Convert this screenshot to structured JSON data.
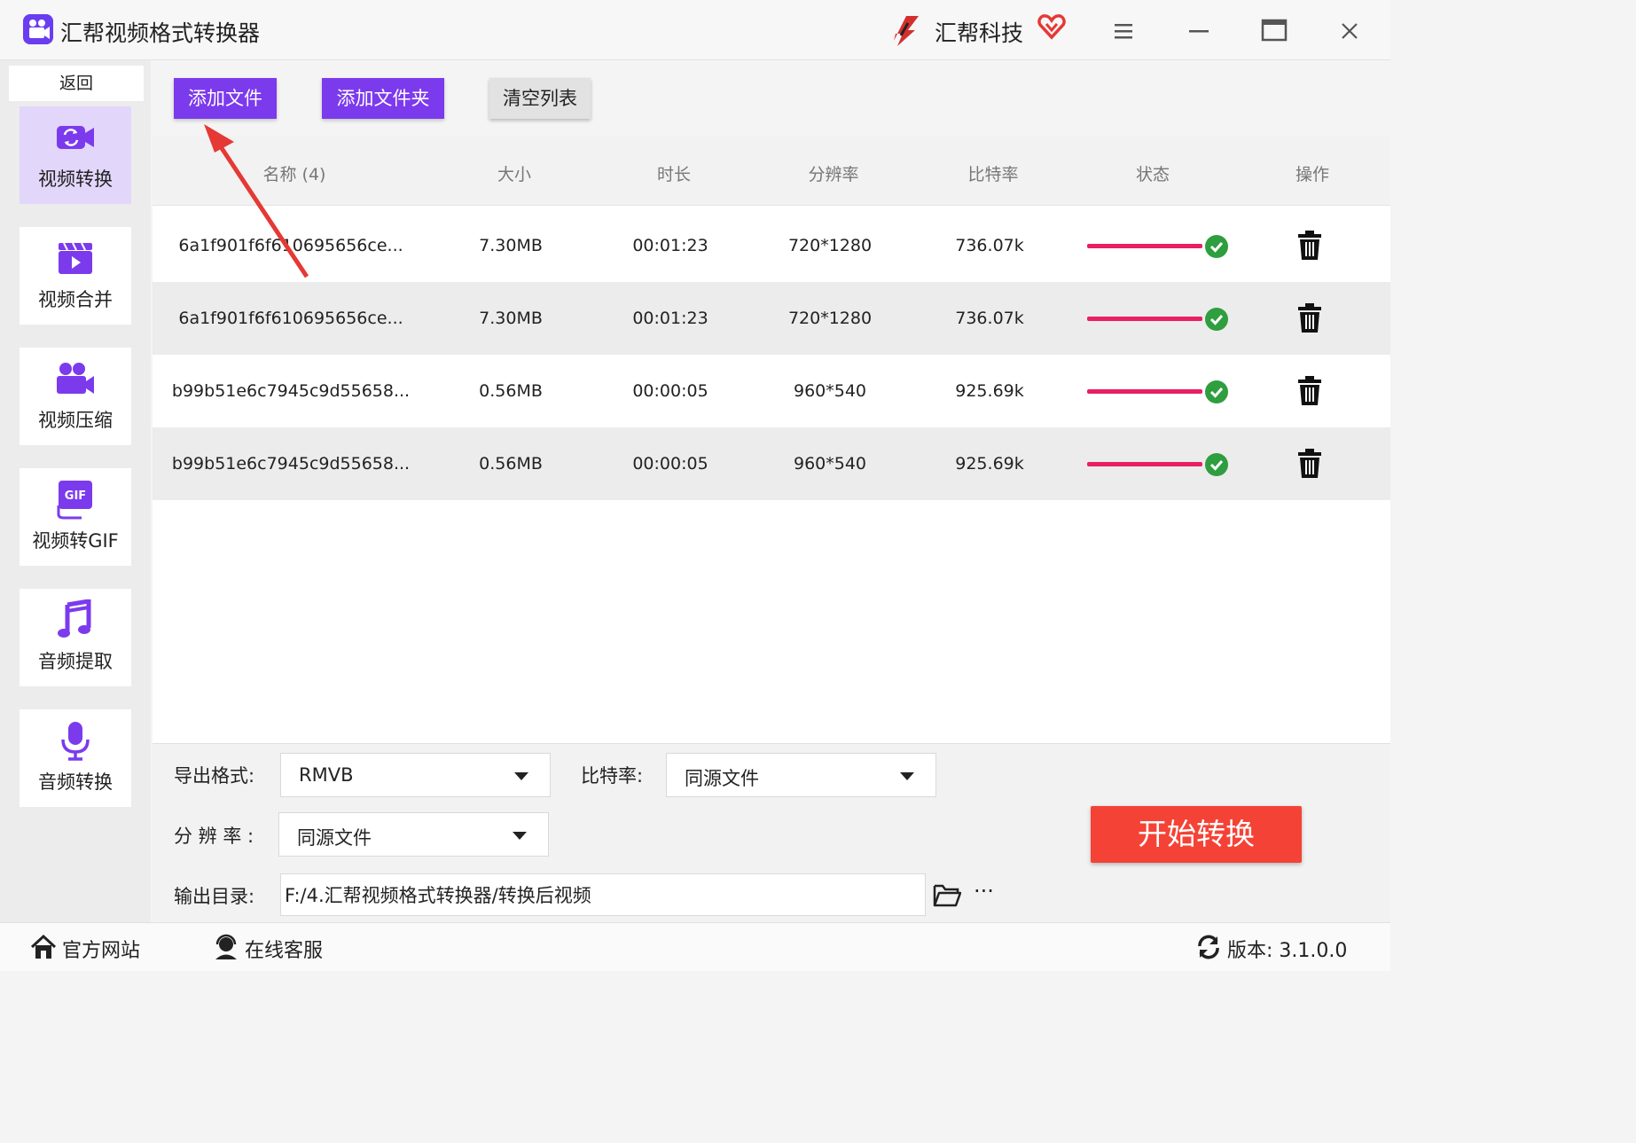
{
  "titlebar": {
    "title": "汇帮视频格式转换器",
    "brand": "汇帮科技",
    "icons": [
      "app-logo-icon",
      "brand-logo-icon",
      "vip-heart-icon",
      "menu-icon",
      "minimize-icon",
      "maximize-icon",
      "close-icon"
    ]
  },
  "sidebar": {
    "back_label": "返回",
    "items": [
      {
        "label": "视频转换",
        "icon": "video-convert-icon",
        "active": true
      },
      {
        "label": "视频合并",
        "icon": "video-merge-icon",
        "active": false
      },
      {
        "label": "视频压缩",
        "icon": "video-compress-icon",
        "active": false
      },
      {
        "label": "视频转GIF",
        "icon": "gif-icon",
        "active": false
      },
      {
        "label": "音频提取",
        "icon": "music-note-icon",
        "active": false
      },
      {
        "label": "音频转换",
        "icon": "microphone-icon",
        "active": false
      }
    ]
  },
  "toolbar": {
    "add_file": "添加文件",
    "add_folder": "添加文件夹",
    "clear_list": "清空列表"
  },
  "table": {
    "headers": {
      "name": "名称 (4)",
      "size": "大小",
      "duration": "时长",
      "resolution": "分辨率",
      "bitrate": "比特率",
      "status": "状态",
      "action": "操作"
    },
    "rows": [
      {
        "name": "6a1f901f6f610695656ce...",
        "size": "7.30MB",
        "duration": "00:01:23",
        "resolution": "720*1280",
        "bitrate": "736.07k",
        "progress": 1.0
      },
      {
        "name": "6a1f901f6f610695656ce...",
        "size": "7.30MB",
        "duration": "00:01:23",
        "resolution": "720*1280",
        "bitrate": "736.07k",
        "progress": 1.0
      },
      {
        "name": "b99b51e6c7945c9d55658...",
        "size": "0.56MB",
        "duration": "00:00:05",
        "resolution": "960*540",
        "bitrate": "925.69k",
        "progress": 1.0
      },
      {
        "name": "b99b51e6c7945c9d55658...",
        "size": "0.56MB",
        "duration": "00:00:05",
        "resolution": "960*540",
        "bitrate": "925.69k",
        "progress": 1.0
      }
    ]
  },
  "settings": {
    "format_label": "导出格式:",
    "format_value": "RMVB",
    "bitrate_label": "比特率:",
    "bitrate_value": "同源文件",
    "resolution_label": "分 辨 率 :",
    "resolution_value": "同源文件",
    "output_label": "输出目录:",
    "output_path": "F:/4.汇帮视频格式转换器/转换后视频",
    "more_label": "···",
    "start_label": "开始转换"
  },
  "footer": {
    "website": "官方网站",
    "service": "在线客服",
    "version": "版本: 3.1.0.0"
  },
  "colors": {
    "accent_purple": "#7c3aed",
    "sidebar_active": "#e3d6fb",
    "progress": "#e91e63",
    "success": "#2e9e3f",
    "start_button": "#f44336",
    "annotation_arrow": "#e53935"
  }
}
